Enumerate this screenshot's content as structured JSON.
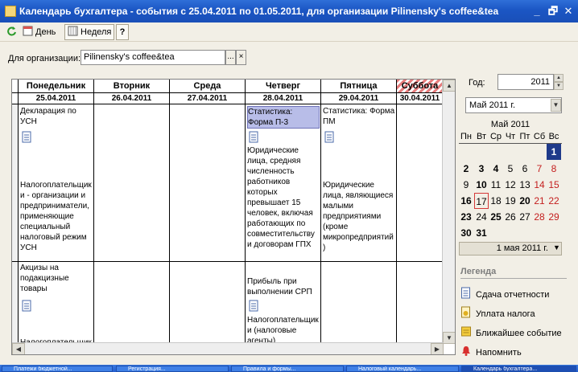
{
  "window": {
    "title": "Календарь бухгалтера - события с 25.04.2011 по 01.05.2011, для организации Pilinensky's coffee&tea",
    "minimize_icon": "_",
    "maximize_icon": "🗗",
    "close_icon": "✕"
  },
  "toolbar": {
    "day_label": "День",
    "week_label": "Неделя",
    "help_label": "?"
  },
  "org": {
    "label": "Для организации:",
    "value": "Pilinensky's coffee&tea",
    "choose_button": "...",
    "clear_button": "×"
  },
  "calendar": {
    "days": [
      {
        "name": "Понедельник",
        "date": "25.04.2011"
      },
      {
        "name": "Вторник",
        "date": "26.04.2011"
      },
      {
        "name": "Среда",
        "date": "27.04.2011"
      },
      {
        "name": "Четверг",
        "date": "28.04.2011"
      },
      {
        "name": "Пятница",
        "date": "29.04.2011"
      },
      {
        "name": "Суббота",
        "date": "30.04.2011"
      }
    ],
    "events": {
      "mon_1": "Декларация по УСН",
      "thu_1": "Статистика: Форма П-3",
      "fri_1": "Статистика: Форма ПМ",
      "mon_2": "Налогоплательщик и - организации и предприниматели, применяющие специальный налоговый режим УСН",
      "thu_2": "Юридические лица, средняя численность работников которых превышает 15 человек, включая работающих по совместительству и договорам ГПХ",
      "fri_2": "Юридические лица, являющиеся малыми предприятиями (кроме микропредприятий)",
      "mon_3": "Акцизы на подакцизные товары",
      "thu_3": "Прибыль при выполнении СРП",
      "mon_4": "Налогоплательщик",
      "thu_4": "Налогоплательщик и (налоговые агенты)"
    }
  },
  "side": {
    "year_label": "Год:",
    "year_value": "2011",
    "month_value": "Май 2011 г.",
    "mini_month_title": "Май 2011",
    "weekdays": [
      "Пн",
      "Вт",
      "Ср",
      "Чт",
      "Пт",
      "Сб",
      "Вс"
    ],
    "days": [
      "1",
      "2",
      "3",
      "4",
      "5",
      "6",
      "7",
      "8",
      "9",
      "10",
      "11",
      "12",
      "13",
      "14",
      "15",
      "16",
      "17",
      "18",
      "19",
      "20",
      "21",
      "22",
      "23",
      "24",
      "25",
      "26",
      "27",
      "28",
      "29",
      "30",
      "31"
    ],
    "footer_date": "1 мая 2011 г.",
    "legend_title": "Легенда",
    "legend": {
      "report": "Сдача отчетности",
      "tax": "Уплата налога",
      "nearest": "Ближайшее событие",
      "remind": "Напомнить"
    }
  },
  "taskbar": {
    "items": [
      "Платежи бюджетной...",
      "Регистрация...",
      "Правила и формы...",
      "Налоговый календарь...",
      "Правила и формы...",
      "Календарь бухгалтера..."
    ]
  },
  "colors": {
    "title_bar": "#1b56c4",
    "selected_event": "#b8bde8",
    "selected_day": "#1f3a8a",
    "weekend_red": "#c41e1e"
  }
}
